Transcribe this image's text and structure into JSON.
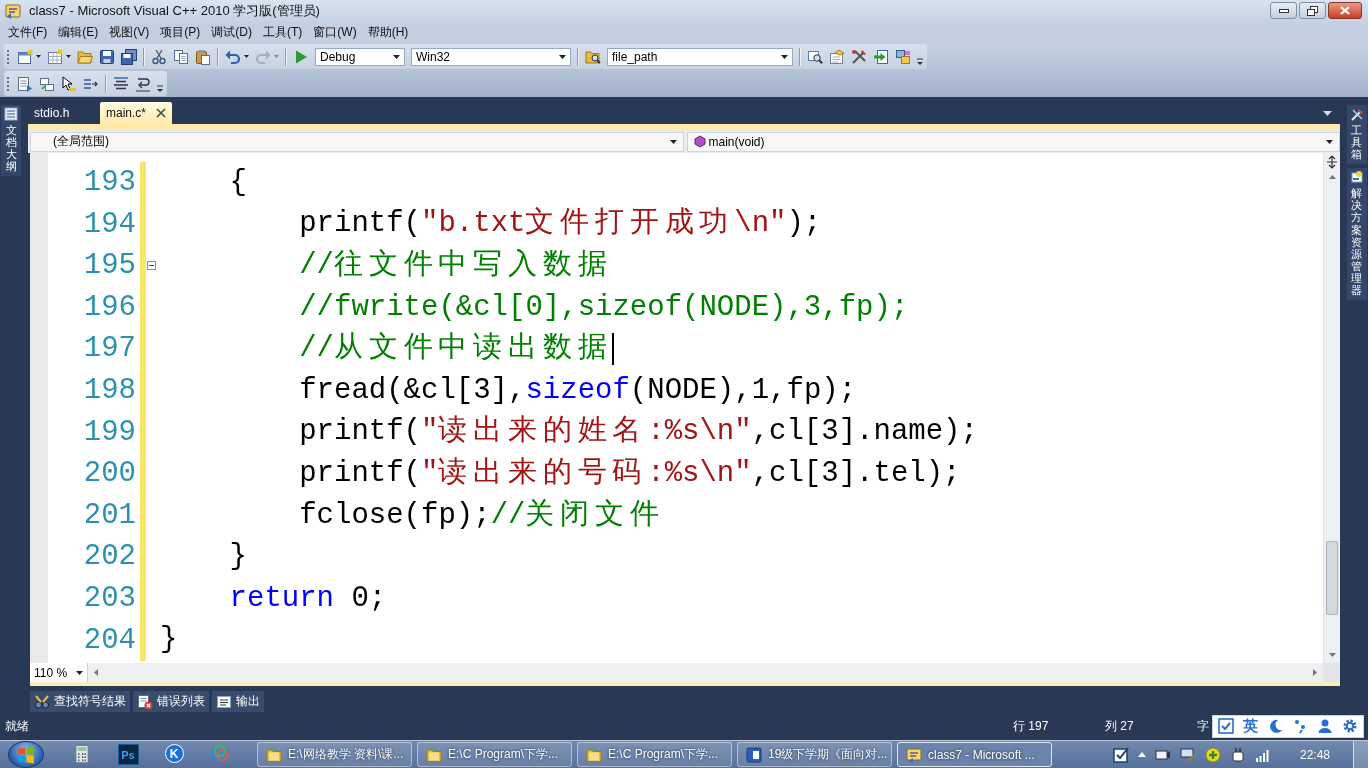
{
  "window": {
    "title": "class7 - Microsoft Visual C++ 2010 学习版(管理员)"
  },
  "menu": [
    "文件(F)",
    "编辑(E)",
    "视图(V)",
    "项目(P)",
    "调试(D)",
    "工具(T)",
    "窗口(W)",
    "帮助(H)"
  ],
  "toolbar": {
    "undo": {
      "disabled": false
    },
    "redo": {
      "disabled": true
    },
    "configuration": "Debug",
    "platform": "Win32",
    "find_field": "file_path"
  },
  "left_panel_tabs": [
    {
      "label": "文档大纲"
    }
  ],
  "right_panel_tabs": [
    {
      "label": "工具箱",
      "kind": "toolbox"
    },
    {
      "label": "解决方案资源管理器",
      "kind": "solution"
    }
  ],
  "document_tabs": [
    {
      "label": "stdio.h",
      "selected": false
    },
    {
      "label": "main.c*",
      "selected": true
    }
  ],
  "navigation": {
    "scope": "(全局范围)",
    "member": "main(void)"
  },
  "editor": {
    "lines": [
      {
        "children": [
          {
            "number": "193",
            "tokens": [
              {
                "text": "{",
                "kind": "plain"
              }
            ],
            "modified": true,
            "fold": false,
            "caret": false,
            "children": [
              {
                "number": "194",
                "tokens": [
                  {
                    "text": "printf(",
                    "kind": "plain"
                  },
                  {
                    "text": "\"b.txt文件打开成功\\n\"",
                    "kind": "string"
                  },
                  {
                    "text": ");",
                    "kind": "plain"
                  }
                ],
                "modified": true,
                "fold": false,
                "caret": false
              },
              {
                "number": "195",
                "tokens": [
                  {
                    "text": "//往文件中写入数据",
                    "kind": "comment"
                  }
                ],
                "modified": true,
                "fold": true,
                "caret": false
              },
              {
                "number": "196",
                "tokens": [
                  {
                    "text": "//fwrite(&cl[0],sizeof(NODE),3,fp);",
                    "kind": "comment"
                  }
                ],
                "modified": true,
                "fold": false,
                "caret": false
              },
              {
                "number": "197",
                "tokens": [
                  {
                    "text": "//从文件中读出数据",
                    "kind": "comment"
                  }
                ],
                "modified": true,
                "fold": false,
                "caret": true
              },
              {
                "number": "198",
                "tokens": [
                  {
                    "text": "fread(&cl[3],",
                    "kind": "plain"
                  },
                  {
                    "text": "sizeof",
                    "kind": "keyword"
                  },
                  {
                    "text": "(NODE),1,fp);",
                    "kind": "plain"
                  }
                ],
                "modified": true,
                "fold": false,
                "caret": false
              },
              {
                "number": "199",
                "tokens": [
                  {
                    "text": "printf(",
                    "kind": "plain"
                  },
                  {
                    "text": "\"读出来的姓名:%s\\n\"",
                    "kind": "string"
                  },
                  {
                    "text": ",cl[3].name);",
                    "kind": "plain"
                  }
                ],
                "modified": true,
                "fold": false,
                "caret": false
              },
              {
                "number": "200",
                "tokens": [
                  {
                    "text": "printf(",
                    "kind": "plain"
                  },
                  {
                    "text": "\"读出来的号码:%s\\n\"",
                    "kind": "string"
                  },
                  {
                    "text": ",cl[3].tel);",
                    "kind": "plain"
                  }
                ],
                "modified": true,
                "fold": false,
                "caret": false
              },
              {
                "number": "201",
                "tokens": [
                  {
                    "text": "fclose(fp);",
                    "kind": "plain"
                  },
                  {
                    "text": "//关闭文件",
                    "kind": "comment"
                  }
                ],
                "modified": true,
                "fold": false,
                "caret": false
              }
            ]
          },
          {
            "number": "202",
            "tokens": [
              {
                "text": "}",
                "kind": "plain"
              }
            ],
            "modified": true,
            "fold": false,
            "caret": false
          },
          {
            "number": "203",
            "tokens": [
              {
                "text": "return",
                "kind": "keyword"
              },
              {
                "text": " 0;",
                "kind": "plain"
              }
            ],
            "modified": true,
            "fold": false,
            "caret": false
          }
        ]
      },
      {
        "number": "204",
        "tokens": [
          {
            "text": "}",
            "kind": "plain"
          }
        ],
        "modified": true,
        "fold": false,
        "caret": false
      }
    ],
    "zoom": "110 %"
  },
  "tool_tabs": [
    {
      "label": "查找符号结果",
      "kind": "symbols"
    },
    {
      "label": "错误列表",
      "kind": "errors"
    },
    {
      "label": "输出",
      "kind": "output"
    }
  ],
  "status_bar": {
    "message": "就绪",
    "line": "行 197",
    "column": "列 27",
    "char": "字"
  },
  "ime_bar": {
    "language": "英"
  },
  "taskbar": {
    "quick_launch": [
      {
        "kind": "calculator"
      },
      {
        "kind": "tile",
        "label": "Ps"
      },
      {
        "kind": "circle",
        "label": "K"
      },
      {
        "kind": "cloud"
      }
    ],
    "tasks": [
      {
        "label": "E:\\网络教学 资料\\课...",
        "kind": "folder",
        "selected": false
      },
      {
        "label": "E:\\C Program\\下学...",
        "kind": "folder",
        "selected": false
      },
      {
        "label": "E:\\C Program\\下学...",
        "kind": "folder",
        "selected": false
      },
      {
        "label": "19级下学期《面向对...",
        "kind": "document",
        "selected": false
      },
      {
        "label": "class7 - Microsoft ...",
        "kind": "ide",
        "selected": true
      }
    ],
    "clock": "22:48"
  }
}
